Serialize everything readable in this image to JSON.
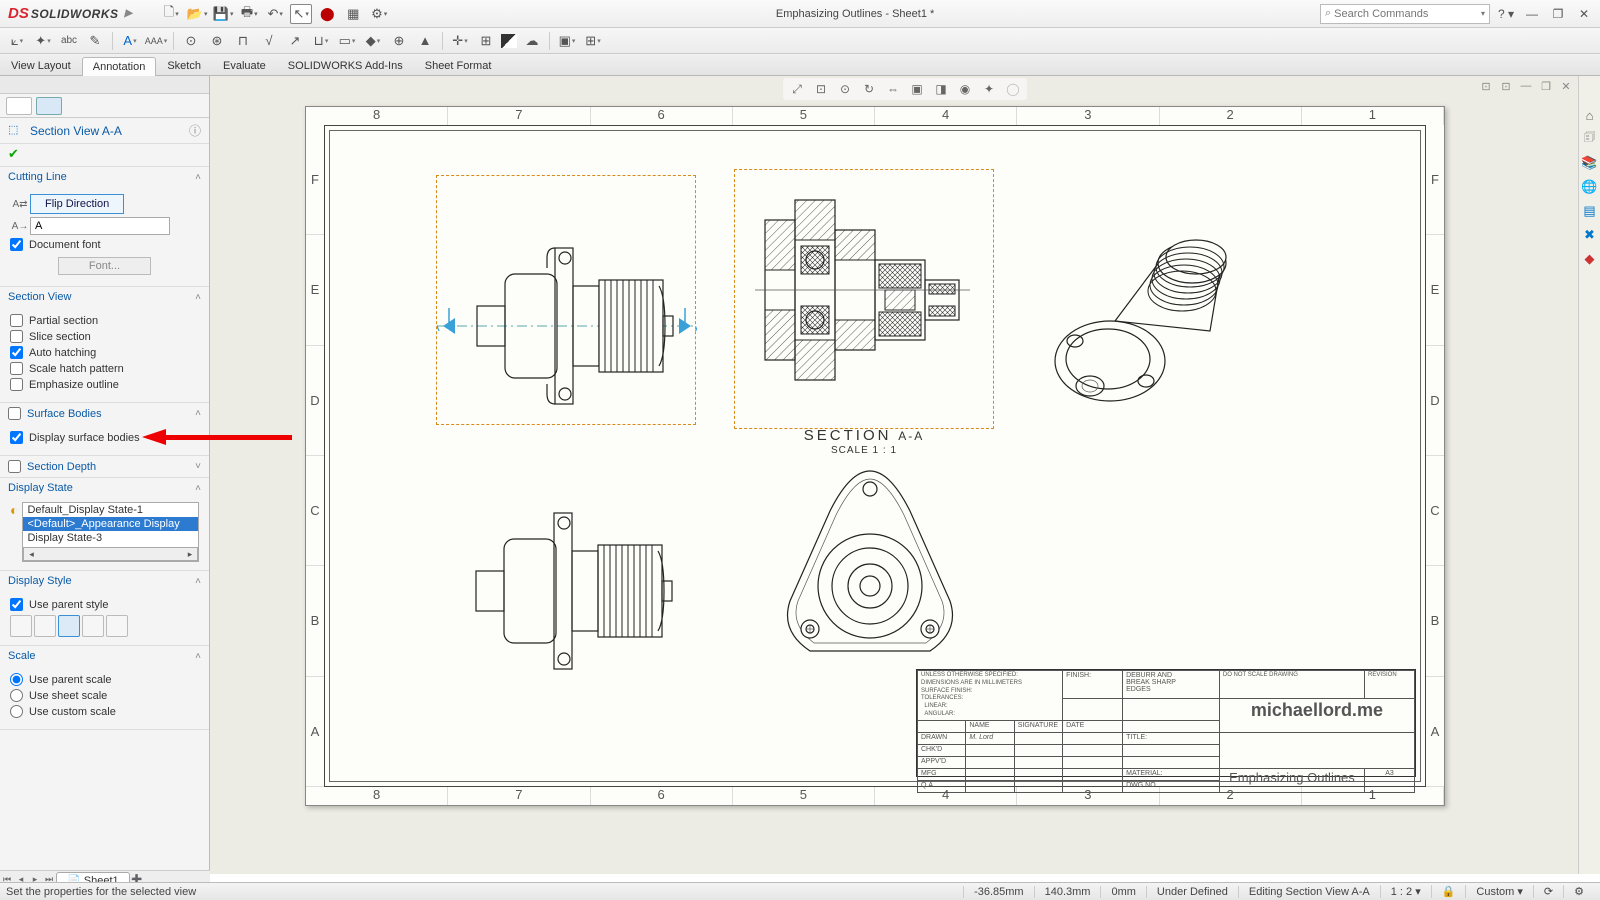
{
  "title": "Emphasizing Outlines - Sheet1 *",
  "logo": {
    "brand": "SOLID",
    "suffix": "WORKS"
  },
  "search_placeholder": "Search Commands",
  "tabs": [
    "View Layout",
    "Annotation",
    "Sketch",
    "Evaluate",
    "SOLIDWORKS Add-Ins",
    "Sheet Format"
  ],
  "active_tab": 1,
  "feature": {
    "name": "Section View A-A",
    "cutting_line": {
      "header": "Cutting Line",
      "flip": "Flip Direction",
      "label_value": "A",
      "doc_font": "Document font",
      "font_btn": "Font..."
    },
    "section_view": {
      "header": "Section View",
      "partial": "Partial section",
      "slice": "Slice section",
      "auto": "Auto hatching",
      "scale": "Scale hatch pattern",
      "emph": "Emphasize outline"
    },
    "surface": {
      "header": "Surface Bodies",
      "display": "Display surface bodies"
    },
    "depth": {
      "header": "Section Depth"
    },
    "display_state": {
      "header": "Display State",
      "items": [
        "Default_Display State-1",
        "<Default>_Appearance Display",
        "Display State-3"
      ],
      "selected": 1
    },
    "display_style": {
      "header": "Display Style",
      "parent": "Use parent style"
    },
    "scale": {
      "header": "Scale",
      "parent": "Use parent scale",
      "sheet": "Use sheet scale",
      "custom": "Use custom scale"
    }
  },
  "ruler_cols": [
    "8",
    "7",
    "6",
    "5",
    "4",
    "3",
    "2",
    "1"
  ],
  "ruler_rows": [
    "F",
    "E",
    "D",
    "C",
    "B",
    "A"
  ],
  "section_label": "SECTION",
  "section_suffix": "A-A",
  "section_scale": "SCALE 1 : 1",
  "titleblock": {
    "brand": "michaellord.me",
    "drawing_title": "Emphasizing Outlines",
    "size": "A3",
    "signer": "M. Lord",
    "hdr_name": "NAME",
    "hdr_sig": "SIGNATURE",
    "hdr_date": "DATE",
    "hdr_title": "TITLE:",
    "hdr_dwg": "DWG NO."
  },
  "sheet_tab": "Sheet1",
  "status": {
    "hint": "Set the properties for the selected view",
    "x": "-36.85mm",
    "y": "140.3mm",
    "z": "0mm",
    "def": "Under Defined",
    "edit": "Editing Section View A-A",
    "ratio": "1 : 2",
    "custom": "Custom"
  }
}
